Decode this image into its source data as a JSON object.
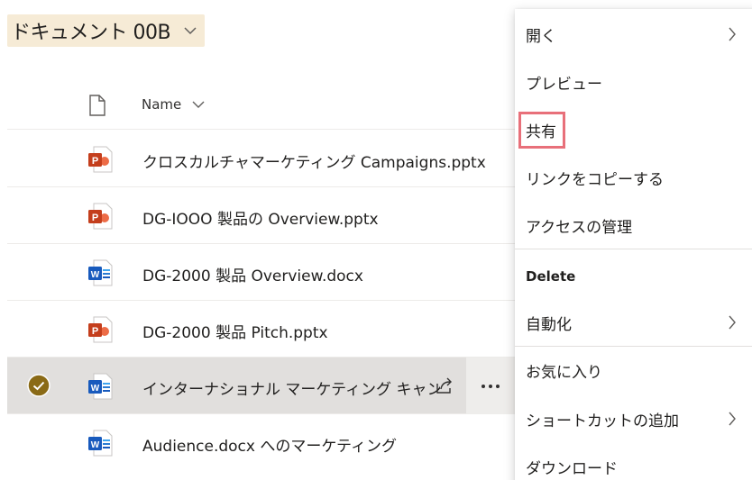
{
  "library": {
    "title": "ドキュメント 00B"
  },
  "header": {
    "name_label": "Name"
  },
  "files": [
    {
      "name": "クロスカルチャマーケティング Campaigns.pptx",
      "type": "pptx",
      "selected": false
    },
    {
      "name": "DG-IOOO 製品の Overview.pptx",
      "type": "pptx",
      "selected": false
    },
    {
      "name": "DG-2000 製品 Overview.docx",
      "type": "docx",
      "selected": false
    },
    {
      "name": "DG-2000 製品 Pitch.pptx",
      "type": "pptx",
      "selected": false
    },
    {
      "name": "インターナショナル マーケティング キャンプ",
      "type": "docx",
      "selected": true
    },
    {
      "name": "Audience.docx へのマーケティング",
      "type": "docx",
      "selected": false
    }
  ],
  "context_menu": {
    "items": [
      {
        "label": "開く",
        "has_submenu": true
      },
      {
        "label": "プレビュー",
        "has_submenu": false
      },
      {
        "label": "共有",
        "has_submenu": false,
        "highlighted": true
      },
      {
        "label": "リンクをコピーする",
        "has_submenu": false
      },
      {
        "label": "アクセスの管理",
        "has_submenu": false
      },
      {
        "label": "Delete",
        "has_submenu": false,
        "bold": true
      },
      {
        "label": "自動化",
        "has_submenu": true
      },
      {
        "label": "お気に入り",
        "has_submenu": false
      },
      {
        "label": "ショートカットの追加",
        "has_submenu": true
      },
      {
        "label": "ダウンロード",
        "has_submenu": false
      }
    ]
  },
  "colors": {
    "title_highlight": "#f6ebd6",
    "selected_row": "#e1dfdd",
    "check_fill": "#8a6a16",
    "highlight_box": "#e8707a",
    "pptx": "#c43e1c",
    "docx": "#185abd"
  }
}
